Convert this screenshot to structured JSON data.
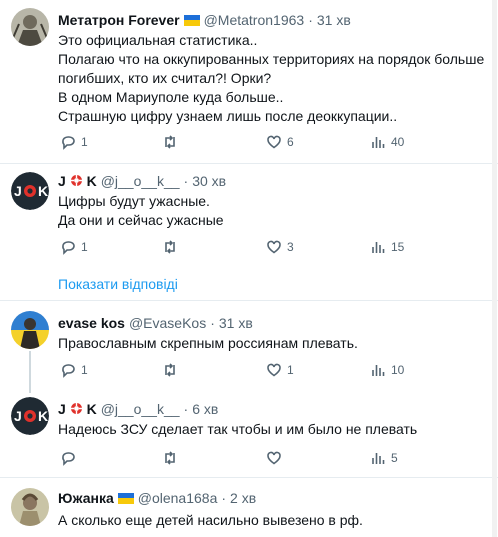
{
  "tweets": [
    {
      "name": "Метатрон Forever",
      "handle": "@Metatron1963",
      "dot": "·",
      "time": "31 хв",
      "lines": [
        "Это официальная статистика..",
        "Полагаю что на оккупированных территориях на порядок больше",
        "погибших, кто их считал?! Орки?",
        "В одном Мариуполе куда больше..",
        "Страшную цифру узнаем лишь после деоккупации.."
      ],
      "replies": "1",
      "retweets": "",
      "likes": "6",
      "views": "40"
    },
    {
      "name_prefix": "J",
      "name_suffix": "K",
      "handle": "@j__o__k__",
      "dot": "·",
      "time": "30 хв",
      "lines": [
        "Цифры будут ужасные.",
        "Да они и сейчас ужасные"
      ],
      "replies": "1",
      "retweets": "",
      "likes": "3",
      "views": "15"
    },
    {
      "name": "evase kos",
      "handle": "@EvaseKos",
      "dot": "·",
      "time": "31 хв",
      "lines": [
        "Православным скрепным россиянам плевать."
      ],
      "replies": "1",
      "retweets": "",
      "likes": "1",
      "views": "10"
    },
    {
      "name_prefix": "J",
      "name_suffix": "K",
      "handle": "@j__o__k__",
      "dot": "·",
      "time": "6 хв",
      "lines": [
        "Надеюсь ЗСУ сделает так чтобы и им было не плевать"
      ],
      "replies": "",
      "retweets": "",
      "likes": "",
      "views": "5"
    },
    {
      "name": "Южанка",
      "handle": "@olena168a",
      "dot": "·",
      "time": "2 хв",
      "lines": [
        "А сколько еще детей насильно вывезено в рф."
      ]
    }
  ],
  "show_replies": "Показати відповіді",
  "colors": {
    "link": "#1d9bf0",
    "muted": "#536471",
    "flag_blue": "#1d6fd8",
    "flag_yellow": "#f7c90a"
  },
  "icons": [
    "reply-icon",
    "retweet-icon",
    "like-icon",
    "views-icon",
    "lifebuoy-icon",
    "flag-ukraine-icon"
  ]
}
